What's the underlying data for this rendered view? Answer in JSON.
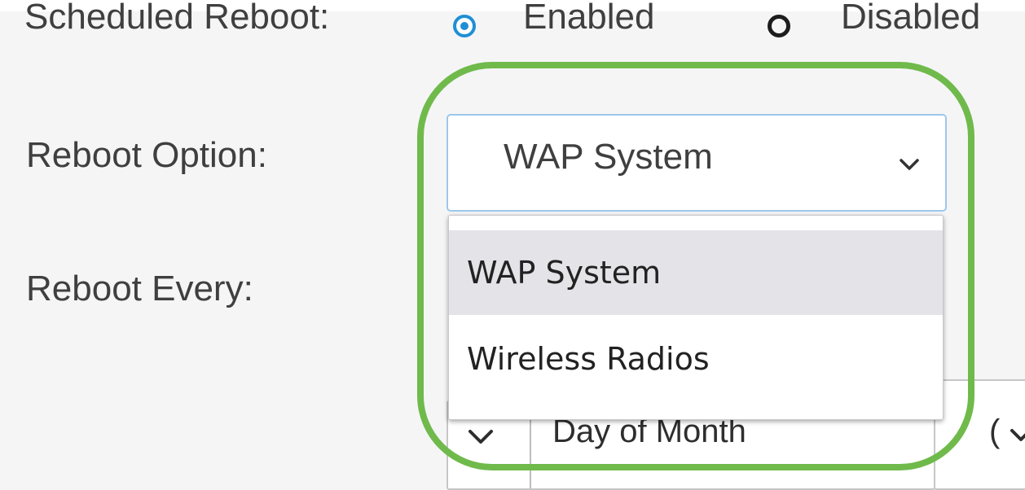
{
  "scheduled_reboot": {
    "label": "Scheduled Reboot:",
    "options": [
      {
        "label": "Enabled",
        "checked": true
      },
      {
        "label": "Disabled",
        "checked": false
      }
    ]
  },
  "reboot_option": {
    "label": "Reboot Option:",
    "value": "WAP System",
    "dropdown_items": [
      {
        "label": "WAP System",
        "highlighted": true
      },
      {
        "label": "Wireless Radios",
        "highlighted": false
      }
    ]
  },
  "reboot_every": {
    "label": "Reboot Every:",
    "period_value": "Day of Month",
    "secondary_value": "("
  },
  "colors": {
    "radio_checked": "#1f8fd6",
    "focus_border": "#9cc8ea",
    "highlight_ring": "#6fba4b",
    "dropdown_hover": "#e3e3e8"
  },
  "icons": {
    "select_chevron": "chevron-down-icon"
  }
}
